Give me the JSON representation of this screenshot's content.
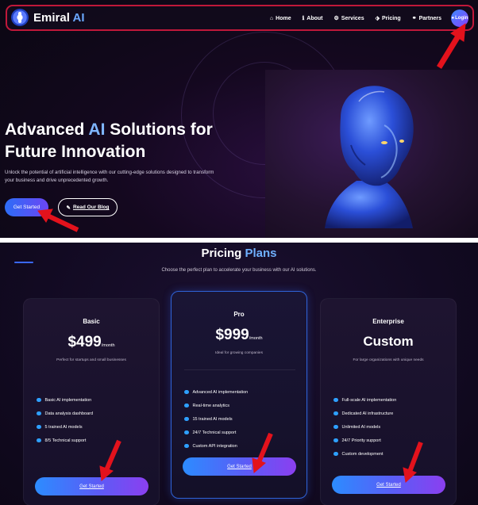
{
  "navbar": {
    "logo_text": "Emiral",
    "logo_accent": "AI",
    "links": [
      {
        "label": "Home",
        "icon": "home-icon",
        "glyph": "⌂"
      },
      {
        "label": "About",
        "icon": "info-icon",
        "glyph": "ℹ"
      },
      {
        "label": "Services",
        "icon": "gears-icon",
        "glyph": "⚙"
      },
      {
        "label": "Pricing",
        "icon": "tag-icon",
        "glyph": "⬗"
      },
      {
        "label": "Partners",
        "icon": "handshake-icon",
        "glyph": "⚭"
      }
    ],
    "login_label": "Login"
  },
  "hero": {
    "title_part1": "Advanced ",
    "title_accent": "AI",
    "title_part2": " Solutions for",
    "title_line2": "Future Innovation",
    "description": "Unlock the potential of artificial intelligence with our cutting-edge solutions designed to transform your business and drive unprecedented growth.",
    "primary_button": "Get Started",
    "secondary_button": "Read Our Blog"
  },
  "pricing": {
    "title_part1": "Pricing ",
    "title_accent": "Plans",
    "subtitle": "Choose the perfect plan to accelerate your business with our AI solutions.",
    "plans": [
      {
        "name": "Basic",
        "price": "$499",
        "period": "/month",
        "description": "Perfect for startups and small businesses",
        "features": [
          "Basic AI implementation",
          "Data analysis dashboard",
          "5 trained AI models",
          "8/5 Technical support"
        ],
        "button": "Get Started"
      },
      {
        "name": "Pro",
        "price": "$999",
        "period": "/month",
        "description": "Ideal for growing companies",
        "features": [
          "Advanced AI implementation",
          "Real-time analytics",
          "15 trained AI models",
          "24/7 Technical support",
          "Custom API integration"
        ],
        "button": "Get Started"
      },
      {
        "name": "Enterprise",
        "price": "Custom",
        "period": "",
        "description": "For large organizations with unique needs",
        "features": [
          "Full-scale AI implementation",
          "Dedicated AI infrastructure",
          "Unlimited AI models",
          "24/7 Priority support",
          "Custom development"
        ],
        "button": "Get Started"
      }
    ]
  },
  "colors": {
    "accent_blue": "#6aa7ff",
    "annotation_red": "#e3121c",
    "nav_border": "#c0183a"
  }
}
